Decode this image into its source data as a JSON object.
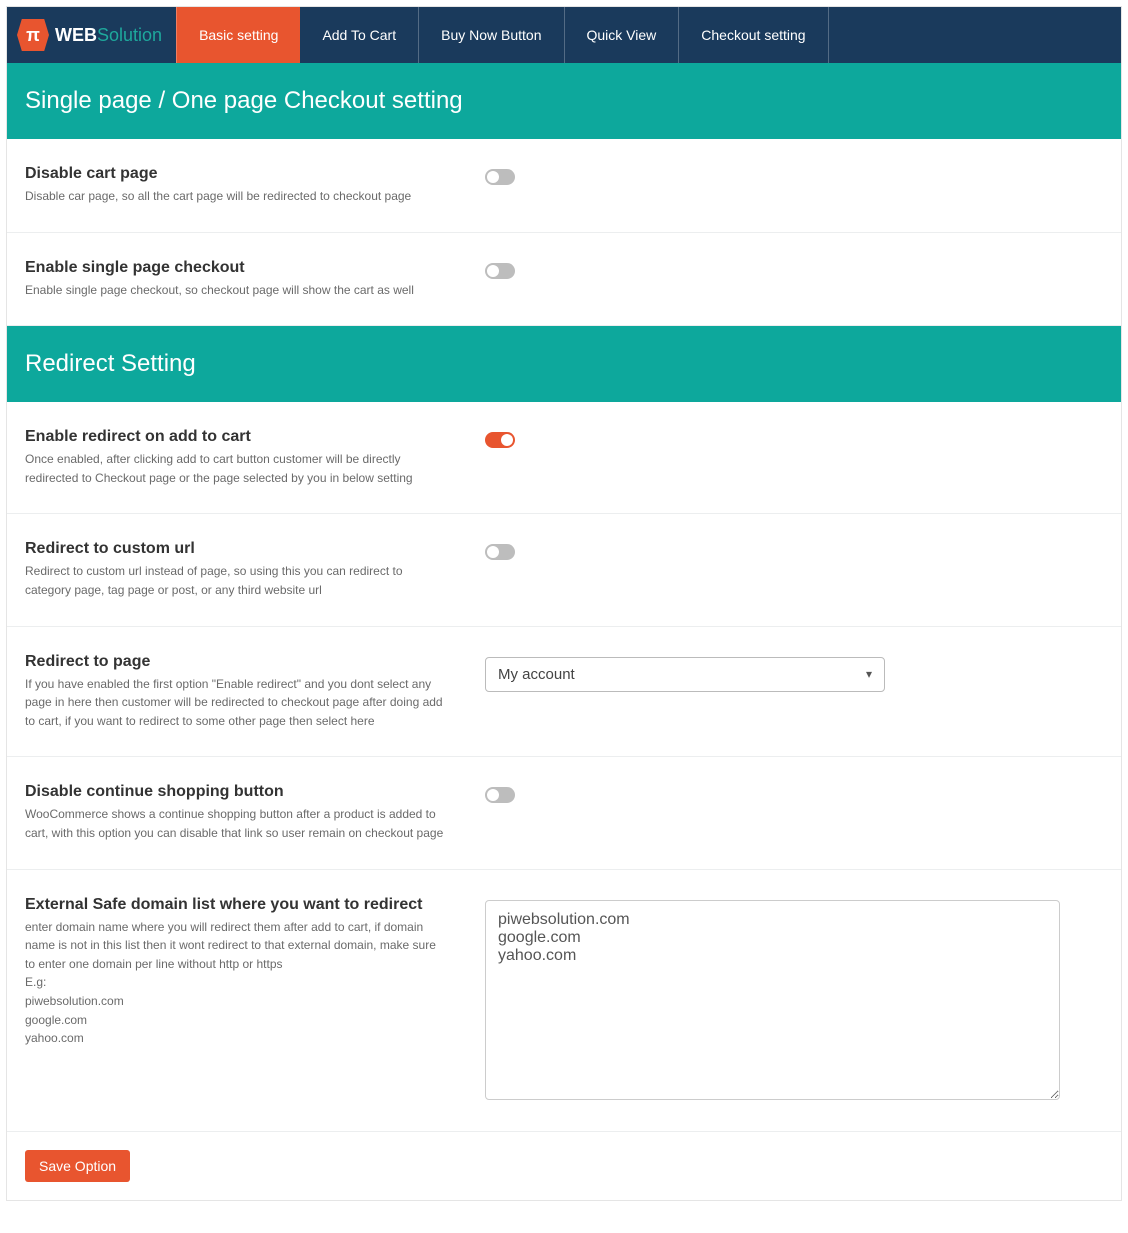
{
  "logo": {
    "icon_glyph": "π",
    "text_main": "WEB",
    "text_accent": "Solution"
  },
  "tabs": [
    {
      "label": "Basic setting",
      "active": true
    },
    {
      "label": "Add To Cart",
      "active": false
    },
    {
      "label": "Buy Now Button",
      "active": false
    },
    {
      "label": "Quick View",
      "active": false
    },
    {
      "label": "Checkout setting",
      "active": false
    }
  ],
  "sections": {
    "checkout": {
      "header": "Single page / One page Checkout setting",
      "rows": [
        {
          "title": "Disable cart page",
          "desc": "Disable car page, so all the cart page will be redirected to checkout page",
          "toggle": false
        },
        {
          "title": "Enable single page checkout",
          "desc": "Enable single page checkout, so checkout page will show the cart as well",
          "toggle": false
        }
      ]
    },
    "redirect": {
      "header": "Redirect Setting",
      "rows": {
        "enable": {
          "title": "Enable redirect on add to cart",
          "desc": "Once enabled, after clicking add to cart button customer will be directly redirected to Checkout page or the page selected by you in below setting",
          "toggle": true
        },
        "custom_url": {
          "title": "Redirect to custom url",
          "desc": "Redirect to custom url instead of page, so using this you can redirect to category page, tag page or post, or any third website url",
          "toggle": false
        },
        "to_page": {
          "title": "Redirect to page",
          "desc": "If you have enabled the first option \"Enable redirect\" and you dont select any page in here then customer will be redirected to checkout page after doing add to cart, if you want to redirect to some other page then select here",
          "selected": "My account"
        },
        "disable_continue": {
          "title": "Disable continue shopping button",
          "desc": "WooCommerce shows a continue shopping button after a product is added to cart, with this option you can disable that link so user remain on checkout page",
          "toggle": false
        },
        "safe_domains": {
          "title": "External Safe domain list where you want to redirect",
          "desc": "enter domain name where you will redirect them after add to cart, if domain name is not in this list then it wont redirect to that external domain, make sure to enter one domain per line without http or https\nE.g:\npiwebsolution.com\ngoogle.com\nyahoo.com",
          "value": "piwebsolution.com\ngoogle.com\nyahoo.com"
        }
      }
    }
  },
  "save_label": "Save Option"
}
